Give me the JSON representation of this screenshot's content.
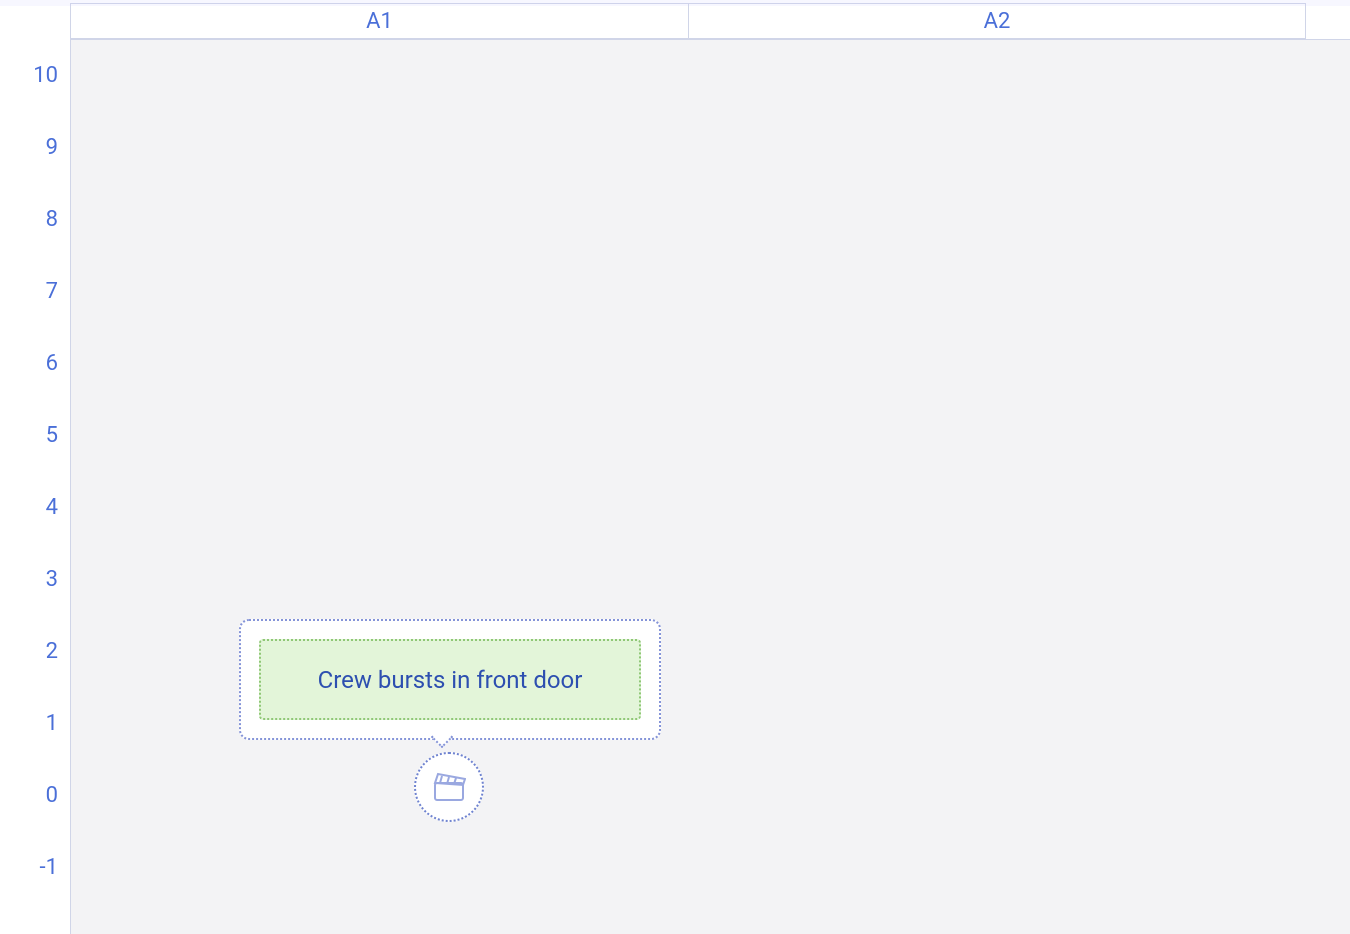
{
  "columns": [
    {
      "label": "A1"
    },
    {
      "label": "A2"
    }
  ],
  "rows": [
    {
      "label": "10"
    },
    {
      "label": "9"
    },
    {
      "label": "8"
    },
    {
      "label": "7"
    },
    {
      "label": "6"
    },
    {
      "label": "5"
    },
    {
      "label": "4"
    },
    {
      "label": "3"
    },
    {
      "label": "2"
    },
    {
      "label": "1"
    },
    {
      "label": "0"
    },
    {
      "label": "-1"
    }
  ],
  "card": {
    "text": "Crew bursts in front door"
  },
  "marker": {
    "icon_name": "clapperboard-icon"
  },
  "colors": {
    "accent": "#4a6fd8",
    "grid_bg": "#f3f3f5",
    "card_inner_bg": "#e3f5d9",
    "card_inner_border": "#8fc776",
    "card_border": "#8594d8"
  }
}
